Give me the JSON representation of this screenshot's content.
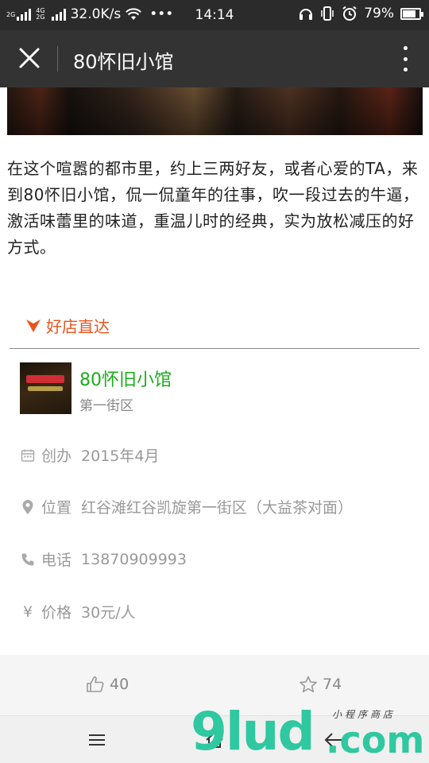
{
  "status_bar": {
    "net_speed": "32.0K/s",
    "net_tags": [
      "4G",
      "2G"
    ],
    "signal_label": "2G",
    "overflow": "•••",
    "time": "14:14",
    "battery": "79%",
    "battery_level": 0.79
  },
  "title_bar": {
    "title": "80怀旧小馆"
  },
  "description": "在这个喧嚣的都市里，约上三两好友，或者心爱的TA，来到80怀旧小馆，侃一侃童年的往事，吹一段过去的牛逼，激活味蕾里的味道，重温儿时的经典，实为放松减压的好方式。",
  "section": {
    "title": "好店直达",
    "accent": "#e8541f"
  },
  "shop": {
    "name": "80怀旧小馆",
    "area": "第一街区",
    "name_color": "#1aad19"
  },
  "info": [
    {
      "icon": "calendar-icon",
      "label": "创办",
      "value": "2015年4月"
    },
    {
      "icon": "location-pin-icon",
      "label": "位置",
      "value": "红谷滩红谷凯旋第一街区（大益茶对面）"
    },
    {
      "icon": "phone-icon",
      "label": "电话",
      "value": "13870909993"
    },
    {
      "icon": "yen-icon",
      "label": "价格",
      "value": "30元/人"
    }
  ],
  "stats": {
    "likes": "40",
    "stars": "74"
  },
  "watermark": {
    "brand": "9lud",
    "suffix": ".com",
    "tagline": "小程序商店"
  }
}
